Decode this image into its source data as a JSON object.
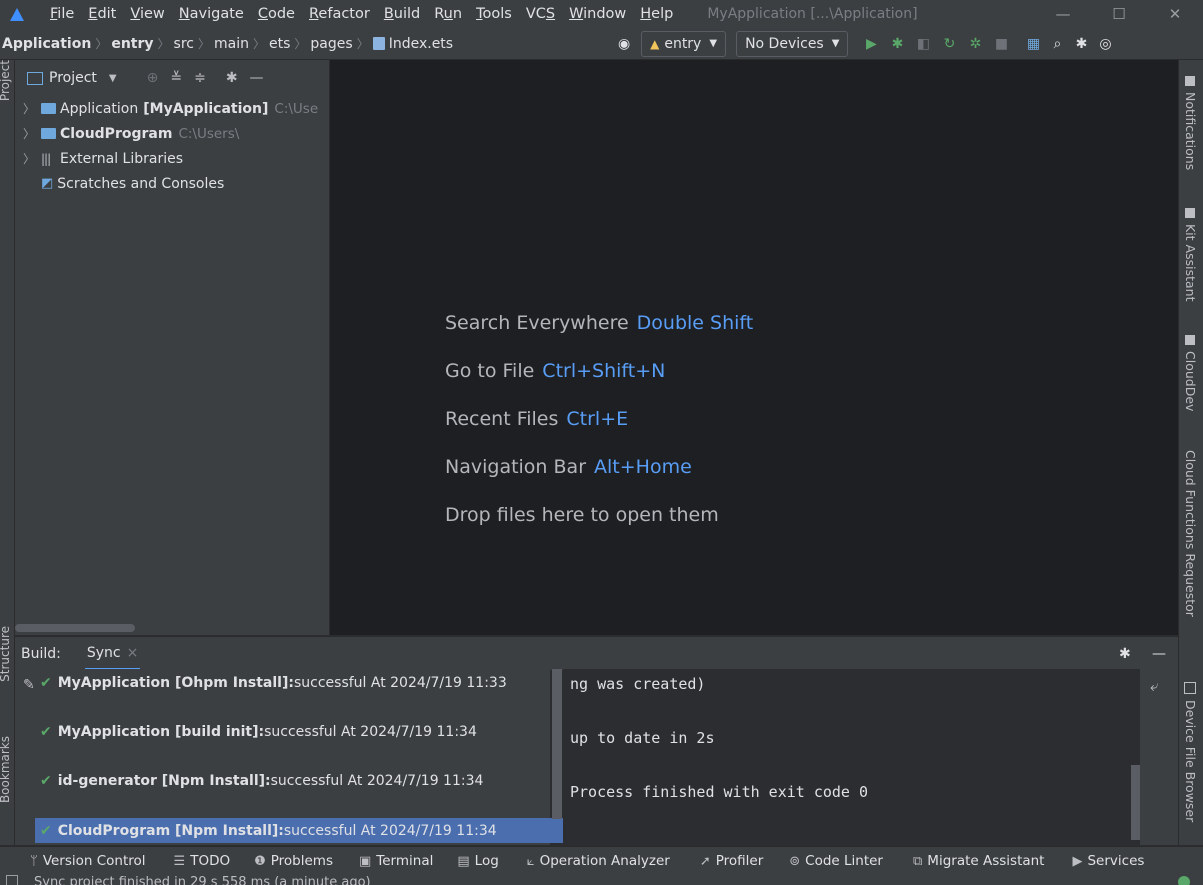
{
  "menubar": {
    "items": [
      {
        "label": "File",
        "mnemonic_index": 0
      },
      {
        "label": "Edit",
        "mnemonic_index": 0
      },
      {
        "label": "View",
        "mnemonic_index": 0
      },
      {
        "label": "Navigate",
        "mnemonic_index": 0
      },
      {
        "label": "Code",
        "mnemonic_index": 0
      },
      {
        "label": "Refactor",
        "mnemonic_index": 0
      },
      {
        "label": "Build",
        "mnemonic_index": 0
      },
      {
        "label": "Run",
        "mnemonic_index": 1
      },
      {
        "label": "Tools",
        "mnemonic_index": 0
      },
      {
        "label": "VCS",
        "mnemonic_index": 2
      },
      {
        "label": "Window",
        "mnemonic_index": 0
      },
      {
        "label": "Help",
        "mnemonic_index": 0
      }
    ],
    "window_title": "MyApplication [...\\Application]",
    "window_controls": {
      "minimize": "—",
      "maximize": "☐",
      "close": "✕"
    }
  },
  "navbar": {
    "breadcrumbs": [
      "Application",
      "entry",
      "src",
      "main",
      "ets",
      "pages",
      "Index.ets"
    ],
    "module_select": "entry",
    "device_select": "No Devices"
  },
  "left_strip": {
    "tabs": [
      "Project",
      "Structure",
      "Bookmarks"
    ]
  },
  "project_panel": {
    "title": "Project",
    "tree": [
      {
        "name": "Application",
        "bold_suffix": "[MyApplication]",
        "path": "C:\\Use",
        "expandable": true
      },
      {
        "name": "CloudProgram",
        "bold_suffix": "",
        "path": "C:\\Users\\",
        "expandable": true
      },
      {
        "name": "External Libraries",
        "bold_suffix": "",
        "path": "",
        "expandable": true
      },
      {
        "name": "Scratches and Consoles",
        "bold_suffix": "",
        "path": "",
        "expandable": false
      }
    ]
  },
  "editor": {
    "hints": [
      {
        "text": "Search Everywhere",
        "key": "Double Shift"
      },
      {
        "text": "Go to File",
        "key": "Ctrl+Shift+N"
      },
      {
        "text": "Recent Files",
        "key": "Ctrl+E"
      },
      {
        "text": "Navigation Bar",
        "key": "Alt+Home"
      },
      {
        "text": "Drop files here to open them",
        "key": ""
      }
    ]
  },
  "right_strip": {
    "tabs": [
      "Notifications",
      "Kit Assistant",
      "CloudDev",
      "Cloud Functions Requestor",
      "Device File Browser"
    ]
  },
  "build_panel": {
    "label": "Build:",
    "tab": "Sync",
    "tab_close": "×",
    "entries": [
      {
        "name": "MyApplication [Ohpm Install]:",
        "status": " successful At 2024/7/19 11:33"
      },
      {
        "name": "MyApplication [build init]:",
        "status": " successful At 2024/7/19 11:34"
      },
      {
        "name": "id-generator [Npm Install]:",
        "status": " successful At 2024/7/19 11:34"
      },
      {
        "name": "CloudProgram [Npm Install]:",
        "status": " successful At 2024/7/19 11:34"
      }
    ],
    "output": [
      "ng was created)",
      "up to date in 2s",
      "Process finished with exit code 0"
    ]
  },
  "bottom_toolbar": {
    "items": [
      {
        "label": "Version Control",
        "icon": "ᛘ"
      },
      {
        "label": "TODO",
        "icon": "☰"
      },
      {
        "label": "Problems",
        "icon": "❶"
      },
      {
        "label": "Terminal",
        "icon": "▣"
      },
      {
        "label": "Log",
        "icon": "▤"
      },
      {
        "label": "Operation Analyzer",
        "icon": "⟀"
      },
      {
        "label": "Profiler",
        "icon": "➚"
      },
      {
        "label": "Code Linter",
        "icon": "⊚"
      },
      {
        "label": "Migrate Assistant",
        "icon": "⧉"
      },
      {
        "label": "Services",
        "icon": "▶"
      }
    ]
  },
  "statusbar": {
    "text": "Sync project finished in 29 s 558 ms (a minute ago)"
  },
  "colors": {
    "accent": "#589df6",
    "success": "#59a869",
    "selection": "#4b6eaf"
  }
}
